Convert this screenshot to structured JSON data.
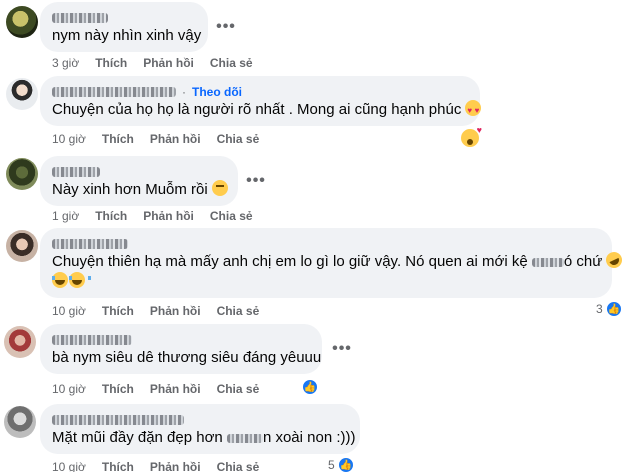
{
  "actions": {
    "like": "Thích",
    "reply": "Phản hồi",
    "share": "Chia sẻ"
  },
  "more_glyph": "•••",
  "comments": [
    {
      "time": "3 giờ",
      "text": "nym này nhìn xinh vậy",
      "emoji": "",
      "follow": "",
      "reactions": ""
    },
    {
      "time": "10 giờ",
      "text": "Chuyện của họ họ là người rõ nhất . Mong ai cũng hạnh phúc",
      "emoji": "smiling-face-heart-eyes",
      "follow": "Theo dõi",
      "reactions": ""
    },
    {
      "time": "1 giờ",
      "text": "Này xinh hơn Muỗm rồi",
      "emoji": "flushed-face",
      "follow": "",
      "reactions": ""
    },
    {
      "time": "10 giờ",
      "text_before": "Chuyện thiên hạ mà mấy anh chị em lo gì lo giữ vậy. Nó quen ai mới kệ",
      "text_after": "ó chứ",
      "emoji": "rolling-on-floor-laughing",
      "follow": "",
      "reactions": "3",
      "reaction_type": "like-surprised"
    },
    {
      "time": "10 giờ",
      "text": "bà nym siêu dê thương siêu đáng yêuuu",
      "emoji": "",
      "follow": "",
      "reactions": "",
      "reaction_type": "like"
    },
    {
      "time": "10 giờ",
      "text_before": "Mặt mũi đầy đặn đẹp hơn",
      "text_after": "n xoài non :)))",
      "emoji": "",
      "follow": "",
      "reactions": "5",
      "reaction_type": "like"
    }
  ]
}
